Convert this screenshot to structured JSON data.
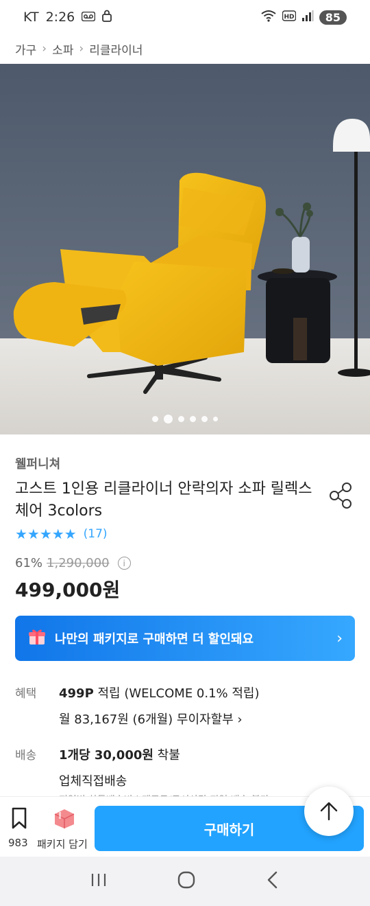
{
  "status": {
    "carrier": "KT",
    "time": "2:26",
    "battery": "85"
  },
  "breadcrumb": [
    "가구",
    "소파",
    "리클라이너"
  ],
  "product": {
    "brand": "웰퍼니쳐",
    "title": "고스트 1인용 리클라이너 안락의자 소파 릴렉스체어 3colors",
    "stars": "★★★★★",
    "review_count": "(17)",
    "discount": "61%",
    "original_price": "1,290,000",
    "price": "499,000원"
  },
  "package_banner": {
    "label": "나만의 패키지로 구매하면 더 할인돼요"
  },
  "benefit": {
    "label": "혜택",
    "points": "499P",
    "points_suffix": " 적립 (WELCOME 0.1% 적립)",
    "installment": "월 83,167원 (6개월) 무이자할부"
  },
  "shipping": {
    "label": "배송",
    "fee_bold": "1개당 30,000원",
    "fee_suffix": " 착불",
    "method": "업체직접배송",
    "note": "지역별 차등배송비 | 제주도/도서산간 지역 배송 불가"
  },
  "bottom_bar": {
    "bookmark_count": "983",
    "package_label": "패키지 담기",
    "buy_label": "구매하기"
  },
  "carousel": {
    "slide_count": 6,
    "active_index": 1
  },
  "colors": {
    "accent": "#22a3ff",
    "star": "#35a6ff"
  }
}
